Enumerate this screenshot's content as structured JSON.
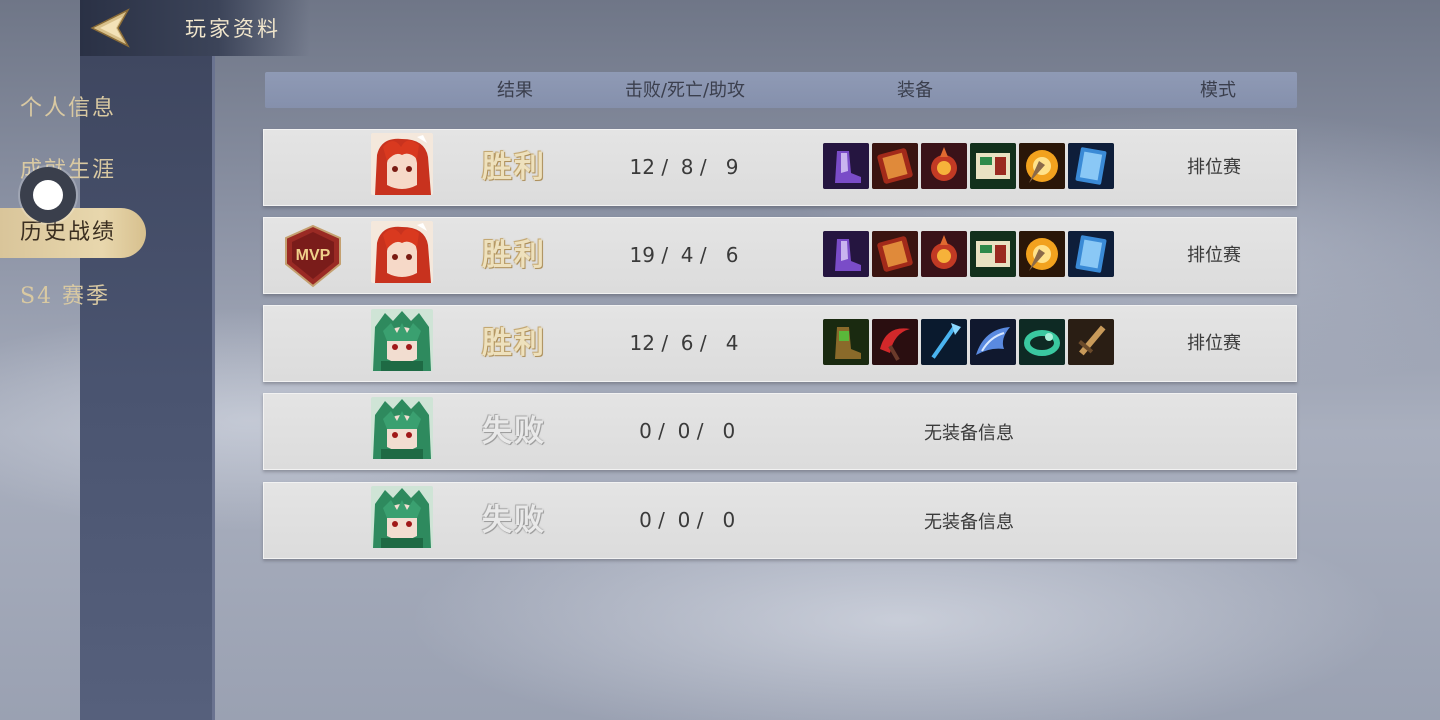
{
  "header": {
    "title": "玩家资料"
  },
  "sidebar": {
    "items": [
      {
        "label": "个人信息"
      },
      {
        "label": "成就生涯"
      },
      {
        "label": "历史战绩"
      },
      {
        "label": "S4 赛季"
      }
    ],
    "active_index": 2
  },
  "table": {
    "headers": {
      "result": "结果",
      "kda": "击败/死亡/助攻",
      "equipment": "装备",
      "mode": "模式"
    },
    "rows": [
      {
        "mvp": false,
        "avatar": "red-hair-hero-avatar",
        "result": "胜利",
        "outcome": "win",
        "kda": "12 /  8 /   9",
        "mode": "排位赛",
        "items": [
          "purple-boots-item-icon",
          "red-tome-item-icon",
          "fire-orb-item-icon",
          "green-scroll-item-icon",
          "flame-shield-item-icon",
          "blue-book-item-icon"
        ]
      },
      {
        "mvp": true,
        "mvp_label": "MVP",
        "avatar": "red-hair-hero-avatar",
        "result": "胜利",
        "outcome": "win",
        "kda": "19 /  4 /   6",
        "mode": "排位赛",
        "items": [
          "purple-boots-item-icon",
          "red-tome-item-icon",
          "fire-orb-item-icon",
          "green-scroll-item-icon",
          "flame-shield-item-icon",
          "blue-book-item-icon"
        ]
      },
      {
        "mvp": false,
        "avatar": "green-hair-hero-avatar",
        "result": "胜利",
        "outcome": "win",
        "kda": "12 /  6 /   4",
        "mode": "排位赛",
        "items": [
          "green-boots-item-icon",
          "red-scythe-item-icon",
          "blue-trident-item-icon",
          "blue-wing-item-icon",
          "jade-ring-item-icon",
          "bronze-blade-item-icon"
        ]
      },
      {
        "mvp": false,
        "avatar": "green-hair-hero-avatar",
        "result": "失败",
        "outcome": "loss",
        "kda": " 0 /  0 /   0",
        "no_items": "无装备信息",
        "mode": ""
      },
      {
        "mvp": false,
        "avatar": "green-hair-hero-avatar",
        "result": "失败",
        "outcome": "loss",
        "kda": " 0 /  0 /   0",
        "no_items": "无装备信息",
        "mode": ""
      }
    ]
  },
  "colors": {
    "accent_gold": "#e8d7ad",
    "sidebar_bg": "#4a5470",
    "row_bg": "#e0e0e0",
    "header_bg": "#8a95b0"
  }
}
